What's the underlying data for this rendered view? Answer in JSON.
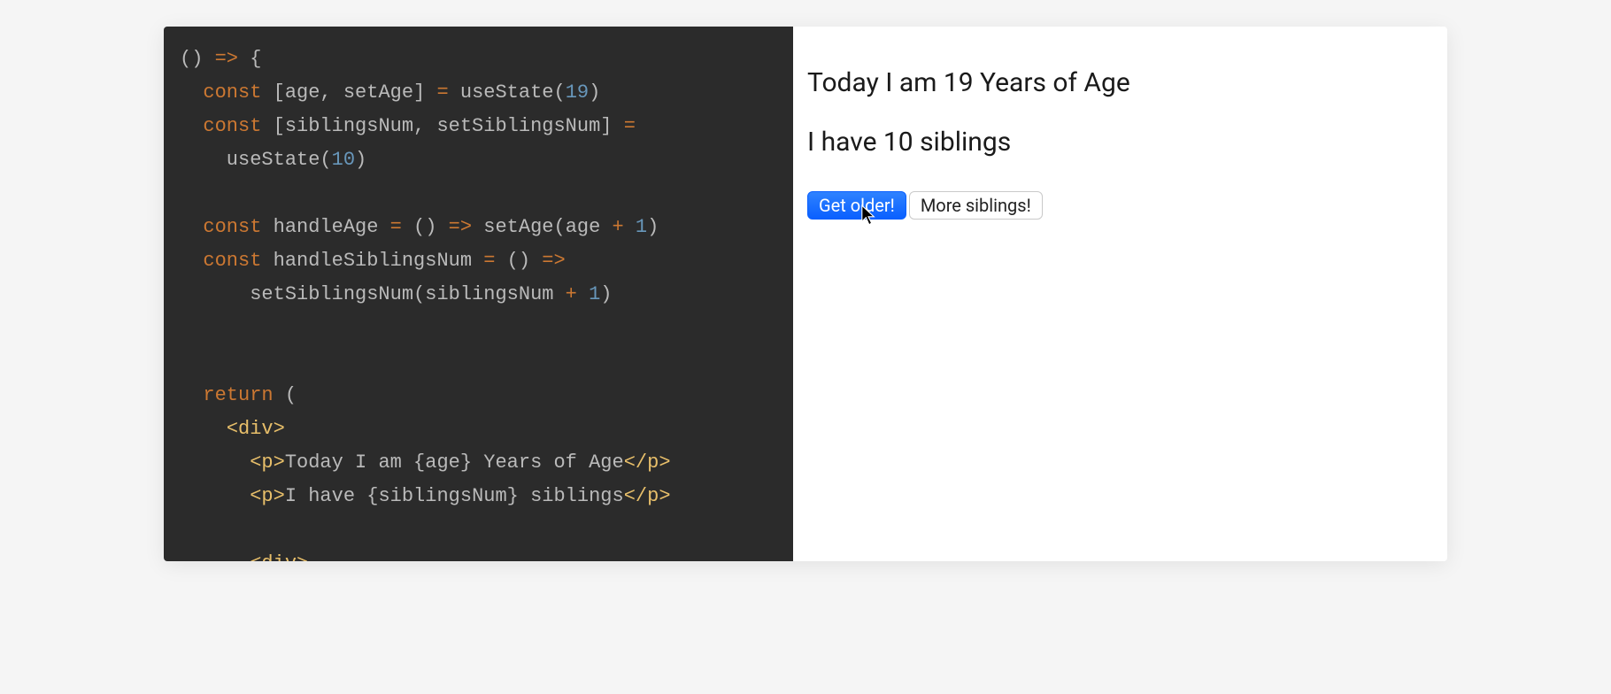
{
  "code": {
    "lines": [
      {
        "segments": [
          {
            "cls": "tok-gray",
            "text": "() "
          },
          {
            "cls": "tok-kw",
            "text": "=>"
          },
          {
            "cls": "tok-gray",
            "text": " {"
          }
        ]
      },
      {
        "segments": [
          {
            "cls": "tok-gray",
            "text": "  "
          },
          {
            "cls": "tok-kw",
            "text": "const"
          },
          {
            "cls": "tok-gray",
            "text": " [age, setAge] "
          },
          {
            "cls": "tok-eq",
            "text": "="
          },
          {
            "cls": "tok-gray",
            "text": " useState("
          },
          {
            "cls": "tok-num",
            "text": "19"
          },
          {
            "cls": "tok-gray",
            "text": ")"
          }
        ]
      },
      {
        "segments": [
          {
            "cls": "tok-gray",
            "text": "  "
          },
          {
            "cls": "tok-kw",
            "text": "const"
          },
          {
            "cls": "tok-gray",
            "text": " [siblingsNum, setSiblingsNum] "
          },
          {
            "cls": "tok-eq",
            "text": "="
          }
        ]
      },
      {
        "segments": [
          {
            "cls": "tok-gray",
            "text": "    useState("
          },
          {
            "cls": "tok-num",
            "text": "10"
          },
          {
            "cls": "tok-gray",
            "text": ")"
          }
        ]
      },
      {
        "segments": [
          {
            "cls": "tok-gray",
            "text": " "
          }
        ]
      },
      {
        "segments": [
          {
            "cls": "tok-gray",
            "text": "  "
          },
          {
            "cls": "tok-kw",
            "text": "const"
          },
          {
            "cls": "tok-gray",
            "text": " handleAge "
          },
          {
            "cls": "tok-eq",
            "text": "="
          },
          {
            "cls": "tok-gray",
            "text": " () "
          },
          {
            "cls": "tok-kw",
            "text": "=>"
          },
          {
            "cls": "tok-gray",
            "text": " setAge(age "
          },
          {
            "cls": "tok-eq",
            "text": "+"
          },
          {
            "cls": "tok-gray",
            "text": " "
          },
          {
            "cls": "tok-num",
            "text": "1"
          },
          {
            "cls": "tok-gray",
            "text": ")"
          }
        ]
      },
      {
        "segments": [
          {
            "cls": "tok-gray",
            "text": "  "
          },
          {
            "cls": "tok-kw",
            "text": "const"
          },
          {
            "cls": "tok-gray",
            "text": " handleSiblingsNum "
          },
          {
            "cls": "tok-eq",
            "text": "="
          },
          {
            "cls": "tok-gray",
            "text": " () "
          },
          {
            "cls": "tok-kw",
            "text": "=>"
          }
        ]
      },
      {
        "segments": [
          {
            "cls": "tok-gray",
            "text": "      setSiblingsNum(siblingsNum "
          },
          {
            "cls": "tok-eq",
            "text": "+"
          },
          {
            "cls": "tok-gray",
            "text": " "
          },
          {
            "cls": "tok-num",
            "text": "1"
          },
          {
            "cls": "tok-gray",
            "text": ")"
          }
        ]
      },
      {
        "segments": [
          {
            "cls": "tok-gray",
            "text": " "
          }
        ]
      },
      {
        "segments": [
          {
            "cls": "tok-gray",
            "text": " "
          }
        ]
      },
      {
        "segments": [
          {
            "cls": "tok-gray",
            "text": "  "
          },
          {
            "cls": "tok-kw",
            "text": "return"
          },
          {
            "cls": "tok-gray",
            "text": " ("
          }
        ]
      },
      {
        "segments": [
          {
            "cls": "tok-gray",
            "text": "    "
          },
          {
            "cls": "tok-angle",
            "text": "<"
          },
          {
            "cls": "tok-tag",
            "text": "div"
          },
          {
            "cls": "tok-angle",
            "text": ">"
          }
        ]
      },
      {
        "segments": [
          {
            "cls": "tok-gray",
            "text": "      "
          },
          {
            "cls": "tok-angle",
            "text": "<"
          },
          {
            "cls": "tok-tag",
            "text": "p"
          },
          {
            "cls": "tok-angle",
            "text": ">"
          },
          {
            "cls": "tok-gray",
            "text": "Today I am {age} Years of Age"
          },
          {
            "cls": "tok-angle",
            "text": "</"
          },
          {
            "cls": "tok-tag",
            "text": "p"
          },
          {
            "cls": "tok-angle",
            "text": ">"
          }
        ]
      },
      {
        "segments": [
          {
            "cls": "tok-gray",
            "text": "      "
          },
          {
            "cls": "tok-angle",
            "text": "<"
          },
          {
            "cls": "tok-tag",
            "text": "p"
          },
          {
            "cls": "tok-angle",
            "text": ">"
          },
          {
            "cls": "tok-gray",
            "text": "I have {siblingsNum} siblings"
          },
          {
            "cls": "tok-angle",
            "text": "</"
          },
          {
            "cls": "tok-tag",
            "text": "p"
          },
          {
            "cls": "tok-angle",
            "text": ">"
          }
        ]
      },
      {
        "segments": [
          {
            "cls": "tok-gray",
            "text": " "
          }
        ]
      },
      {
        "segments": [
          {
            "cls": "tok-gray",
            "text": "      "
          },
          {
            "cls": "tok-angle",
            "text": "<"
          },
          {
            "cls": "tok-tag",
            "text": "div"
          },
          {
            "cls": "tok-angle",
            "text": ">"
          }
        ]
      }
    ]
  },
  "preview": {
    "age_line": "Today I am 19 Years of Age",
    "siblings_line": "I have 10 siblings",
    "buttons": {
      "get_older": "Get older!",
      "more_siblings": "More siblings!"
    }
  },
  "colors": {
    "code_bg": "#2b2b2b",
    "keyword": "#cc7832",
    "number": "#6897bb",
    "tag": "#e8bf6a",
    "primary_button": "#0a60ff"
  }
}
